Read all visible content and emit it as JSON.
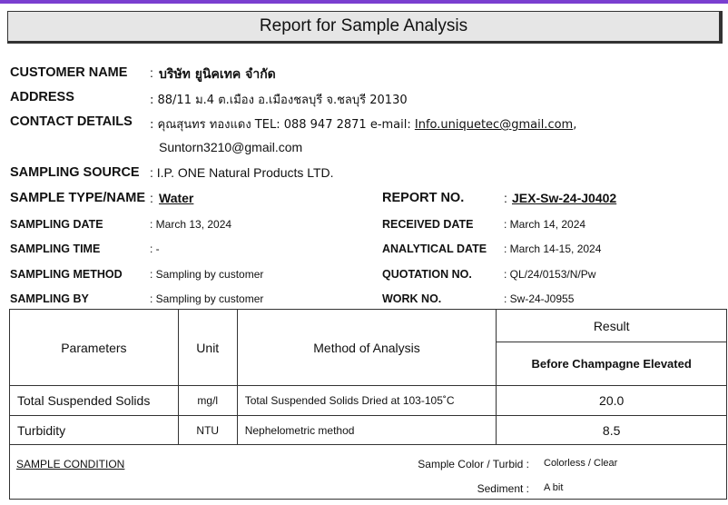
{
  "title": "Report for Sample Analysis",
  "customer": {
    "label": "CUSTOMER NAME",
    "sep": ":",
    "value": "บริษัท ยูนิคเทค จำกัด"
  },
  "address": {
    "label": "ADDRESS",
    "value": ": 88/11 ม.4 ต.เมือง อ.เมืองชลบุรี จ.ชลบุรี 20130"
  },
  "contact": {
    "label": "CONTACT DETAILS",
    "value": ": คุณสุนทร ทองแดง TEL: 088 947 2871   e-mail: ",
    "email1": "Info.uniquetec@gmail.com",
    "email1_suffix": ",",
    "email2": "Suntorn3210@gmail.com"
  },
  "source": {
    "label": "SAMPLING SOURCE",
    "value": ": I.P. ONE Natural Products LTD."
  },
  "sample_type": {
    "label": "SAMPLE TYPE/NAME",
    "sep": ":",
    "value": "Water"
  },
  "report_no": {
    "label": "REPORT NO.",
    "sep": ":",
    "value": "JEX-Sw-24-J0402"
  },
  "sampling_date": {
    "label": "SAMPLING DATE",
    "value": ": March 13, 2024"
  },
  "received_date": {
    "label": "RECEIVED DATE",
    "value": ": March 14, 2024"
  },
  "sampling_time": {
    "label": "SAMPLING TIME",
    "value": ": -"
  },
  "analytical_date": {
    "label": "ANALYTICAL DATE",
    "value": ": March 14-15, 2024"
  },
  "sampling_method": {
    "label": "SAMPLING METHOD",
    "value": ": Sampling by customer"
  },
  "quotation_no": {
    "label": "QUOTATION NO.",
    "value": ": QL/24/0153/N/Pw"
  },
  "sampling_by": {
    "label": "SAMPLING BY",
    "value": ": Sampling by customer"
  },
  "work_no": {
    "label": "WORK NO.",
    "value": ": Sw-24-J0955"
  },
  "table": {
    "headers": {
      "parameters": "Parameters",
      "unit": "Unit",
      "method": "Method of Analysis",
      "result": "Result",
      "sample": "Before Champagne Elevated"
    },
    "rows": [
      {
        "parameter": "Total Suspended Solids",
        "unit": "mg/l",
        "method": "Total Suspended Solids Dried at 103-105˚C",
        "result": "20.0"
      },
      {
        "parameter": "Turbidity",
        "unit": "NTU",
        "method": "Nephelometric method",
        "result": "8.5"
      }
    ]
  },
  "condition": {
    "label": "SAMPLE CONDITION",
    "color_label": "Sample Color / Turbid :",
    "color_value": "Colorless / Clear",
    "sediment_label": "Sediment :",
    "sediment_value": "A bit"
  }
}
